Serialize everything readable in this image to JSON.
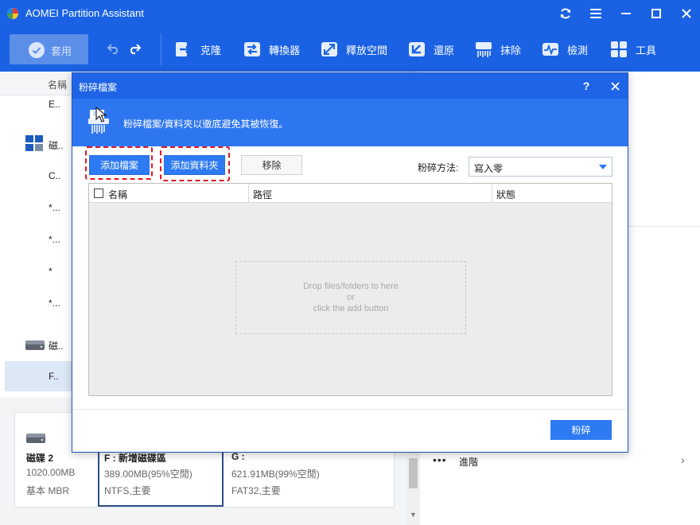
{
  "app": {
    "title": "AOMEI Partition Assistant"
  },
  "toolbar": {
    "apply_label": "套用",
    "items": [
      {
        "label": "克隆",
        "icon": "clone-icon"
      },
      {
        "label": "轉換器",
        "icon": "convert-icon"
      },
      {
        "label": "釋放空間",
        "icon": "free-space-icon"
      },
      {
        "label": "還原",
        "icon": "recovery-icon"
      },
      {
        "label": "抹除",
        "icon": "wipe-icon"
      },
      {
        "label": "檢測",
        "icon": "test-icon"
      },
      {
        "label": "工具",
        "icon": "tools-icon"
      }
    ]
  },
  "list": {
    "col_name": "名稱",
    "rows": [
      {
        "label": "E.."
      },
      {
        "label": "磁.."
      },
      {
        "label": "C.."
      },
      {
        "label": "*..."
      },
      {
        "label": "*..."
      },
      {
        "label": "*"
      },
      {
        "label": "*..."
      },
      {
        "label": "磁.."
      },
      {
        "label": "F.."
      }
    ]
  },
  "disk2": {
    "name": "磁碟 2",
    "size": "1020.00MB",
    "type": "基本 MBR",
    "partitions": [
      {
        "name": "F : 新增磁碟區",
        "size": "389.00MB(95%空閒)",
        "fs": "NTFS,主要"
      },
      {
        "name": "G :",
        "size": "621.91MB(99%空閒)",
        "fs": "FAT32,主要"
      }
    ]
  },
  "right_panel": {
    "advanced_label": "進階"
  },
  "dialog": {
    "title": "粉碎檔案",
    "help": "?",
    "banner_text": "粉碎檔案/資料夾以徹底避免其被恢復。",
    "add_file_label": "添加檔案",
    "add_folder_label": "添加資料夾",
    "remove_label": "移除",
    "method_label": "粉碎方法:",
    "method_value": "寫入零",
    "table": {
      "col_name": "名稱",
      "col_path": "路徑",
      "col_status": "狀態"
    },
    "drop_zone": {
      "line1": "Drop files/folders to here",
      "line2": "or",
      "line3": "click the add button"
    },
    "shred_label": "粉碎"
  },
  "colors": {
    "accent": "#1a62e3",
    "button_blue": "#2d7af2",
    "highlight_red": "#e4161f"
  }
}
